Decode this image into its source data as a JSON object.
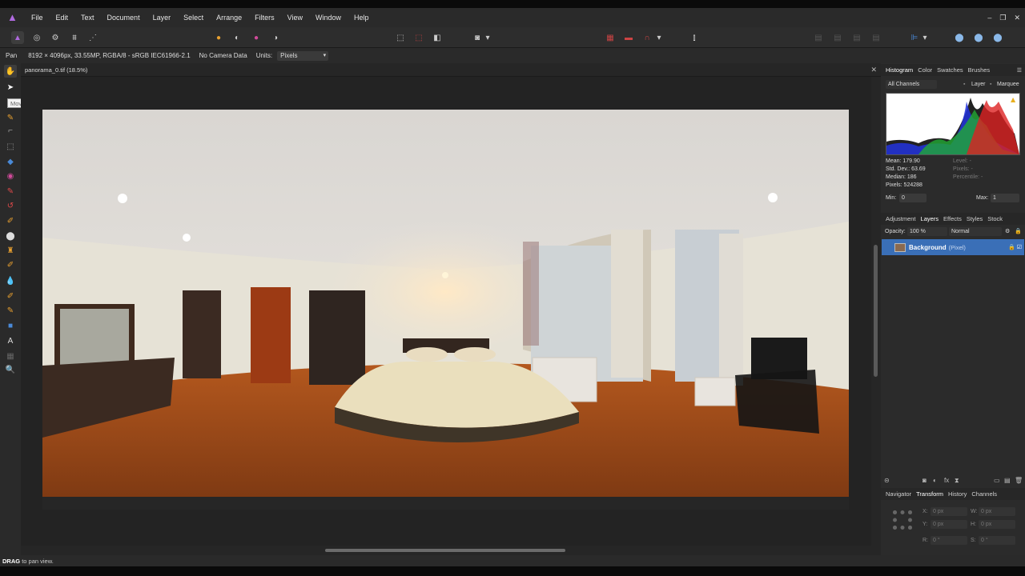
{
  "menu": [
    "File",
    "Edit",
    "Text",
    "Document",
    "Layer",
    "Select",
    "Arrange",
    "Filters",
    "View",
    "Window",
    "Help"
  ],
  "window_controls": [
    "‒",
    "❐",
    "✕"
  ],
  "context": {
    "tool": "Pan",
    "info": "8192 × 4096px, 33.55MP, RGBA/8 - sRGB IEC61966-2.1",
    "camera": "No Camera Data",
    "units_label": "Units:",
    "units_value": "Pixels"
  },
  "tooltip": "Move Tool [V]",
  "document": {
    "tab_label": "panorama_0.tif (18.5%)",
    "close": "✕"
  },
  "status": {
    "key": "DRAG",
    "text": "to pan view."
  },
  "histogram": {
    "tabs": [
      "Histogram",
      "Color",
      "Swatches",
      "Brushes"
    ],
    "channel": "All Channels",
    "layer_label": "Layer",
    "marquee_label": "Marquee",
    "stats": {
      "mean": "Mean: 179.90",
      "std": "Std. Dev.: 63.69",
      "median": "Median: 186",
      "pixels": "Pixels: 524288",
      "level": "Level: -",
      "pixels2": "Pixels: -",
      "percentile": "Percentile: -"
    },
    "min_label": "Min:",
    "min_value": "0",
    "max_label": "Max:",
    "max_value": "1"
  },
  "layers": {
    "tabs": [
      "Adjustment",
      "Layers",
      "Effects",
      "Styles",
      "Stock"
    ],
    "opacity_label": "Opacity:",
    "opacity_value": "100 %",
    "blend": "Normal",
    "layer_name": "Background",
    "layer_type": "(Pixel)"
  },
  "navigator": {
    "tabs": [
      "Navigator",
      "Transform",
      "History",
      "Channels"
    ],
    "x_label": "X:",
    "x_value": "0 px",
    "y_label": "Y:",
    "y_value": "0 px",
    "w_label": "W:",
    "w_value": "0 px",
    "h_label": "H:",
    "h_value": "0 px",
    "r_label": "R:",
    "r_value": "0 °",
    "s_label": "S:",
    "s_value": "0 °"
  },
  "colors": {
    "accent": "#3a6fb7",
    "logo": "#b06adf"
  }
}
